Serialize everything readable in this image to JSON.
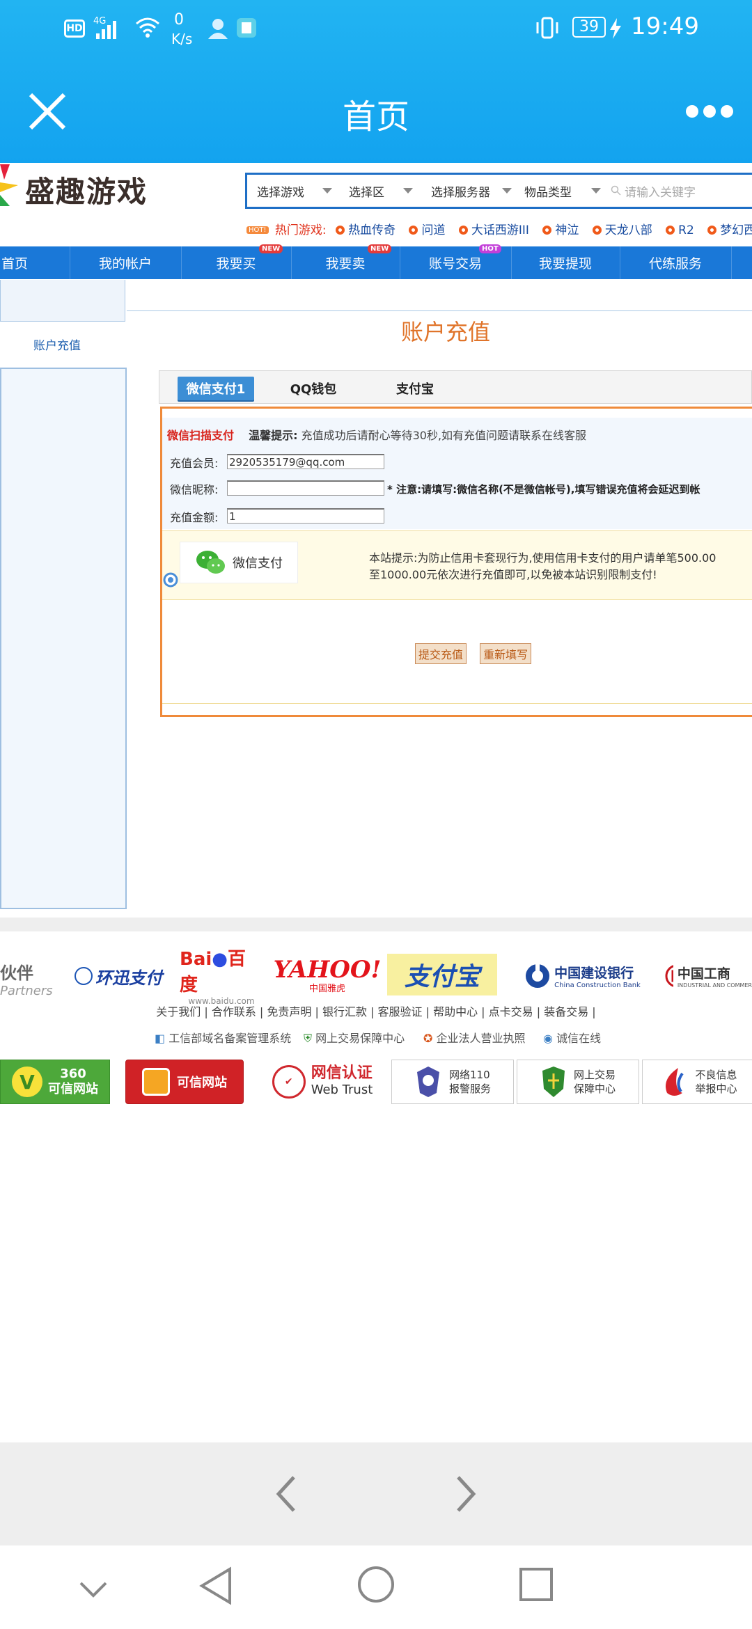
{
  "status_bar": {
    "hd": "HD",
    "network": "4G",
    "speed_value": "0",
    "speed_unit": "K/s",
    "battery": "39",
    "time": "19:49"
  },
  "app_header": {
    "title": "首页"
  },
  "site": {
    "logo_text": "盛趣游戏",
    "search": {
      "select_game": "选择游戏",
      "select_area": "选择区",
      "select_server": "选择服务器",
      "item_type": "物品类型",
      "placeholder": "请输入关键字"
    },
    "hot_games": {
      "tag": "HOT!",
      "label": "热门游戏:",
      "games": [
        "热血传奇",
        "问道",
        "大话西游III",
        "神泣",
        "天龙八部",
        "R2",
        "梦幻西游"
      ]
    },
    "nav": [
      {
        "label": "首页",
        "badge": ""
      },
      {
        "label": "我的帐户",
        "badge": ""
      },
      {
        "label": "我要买",
        "badge": "NEW"
      },
      {
        "label": "我要卖",
        "badge": "NEW"
      },
      {
        "label": "账号交易",
        "badge": "HOT"
      },
      {
        "label": "我要提现",
        "badge": ""
      },
      {
        "label": "代练服务",
        "badge": ""
      }
    ]
  },
  "sidebar": {
    "link": "账户充值"
  },
  "recharge": {
    "title": "账户充值",
    "tabs": [
      "微信支付1",
      "QQ钱包",
      "支付宝"
    ],
    "scan_title": "微信扫描支付",
    "tip_label": "温馨提示:",
    "tip_text": "充值成功后请耐心等待30秒,如有充值问题请联系在线客服",
    "member_label": "充值会员:",
    "member_value": "2920535179@qq.com",
    "nickname_label": "微信昵称:",
    "nickname_value": "",
    "nickname_note": "* 注意:请填写:微信名称(不是微信帐号),填写错误充值将会延迟到帐",
    "amount_label": "充值金额:",
    "amount_value": "1",
    "wechat_pay_label": "微信支付",
    "notice_line1": "本站提示:为防止信用卡套现行为,使用信用卡支付的用户请单笔500.00",
    "notice_line2": "至1000.00元依次进行充值即可,以免被本站识别限制支付!",
    "submit": "提交充值",
    "reset": "重新填写"
  },
  "partners": {
    "left_cn": "伙伴",
    "left_en": "Partners",
    "huanxun": "环迅支付",
    "baidu": "百度",
    "baidu_url": "www.baidu.com",
    "yahoo": "YAHOO!",
    "yahoo_cn": "中国雅虎",
    "alipay": "支付宝",
    "ccb_cn": "中国建设银行",
    "ccb_en": "China Construction Bank",
    "icbc": "中国工商",
    "icbc_en": "INDUSTRIAL AND COMMER"
  },
  "footer": {
    "links": "关于我们 | 合作联系 | 免责声明 | 银行汇款 | 客服验证 | 帮助中心 | 点卡交易 | 装备交易 |",
    "trust": [
      "工信部域名备案管理系统",
      "网上交易保障中心",
      "企业法人营业执照",
      "诚信在线"
    ],
    "badges": {
      "b360_num": "360",
      "b360_text": "可信网站",
      "kexin": "可信网站",
      "wangxin": "网信认证",
      "wangxin_en": "Web Trust",
      "police_1": "网络110",
      "police_2": "报警服务",
      "trade_1": "网上交易",
      "trade_2": "保障中心",
      "bad_1": "不良信息",
      "bad_2": "举报中心"
    }
  },
  "colors": {
    "header_blue": "#13a3ef",
    "nav_blue": "#1a78d8",
    "accent_orange": "#e0742a"
  }
}
